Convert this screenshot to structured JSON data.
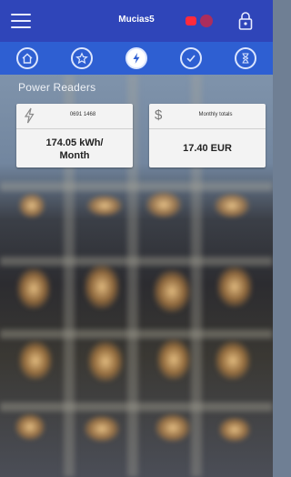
{
  "header": {
    "title": "Mucias5",
    "menu_icon": "hamburger-menu-icon",
    "notification_icon": "notification-icon",
    "lock_icon": "lock-icon"
  },
  "tabs": [
    {
      "icon": "home-icon",
      "active": false
    },
    {
      "icon": "star-icon",
      "active": false
    },
    {
      "icon": "lightning-icon",
      "active": true
    },
    {
      "icon": "check-icon",
      "active": false
    },
    {
      "icon": "hourglass-icon",
      "active": false
    }
  ],
  "section": {
    "title": "Power Readers"
  },
  "cards": [
    {
      "icon": "lightning-icon",
      "caption": "0691 1468",
      "value_line1": "174.05 kWh/",
      "value_line2": "Month"
    },
    {
      "icon": "dollar-icon",
      "symbol": "$",
      "caption": "Monthly totals",
      "value_line1": "17.40 EUR"
    }
  ],
  "colors": {
    "header_bg": "#2f45b9",
    "tabbar_bg": "#2e5fd2",
    "card_bg": "#f3f3f3",
    "notification": "#ff2a3c"
  }
}
